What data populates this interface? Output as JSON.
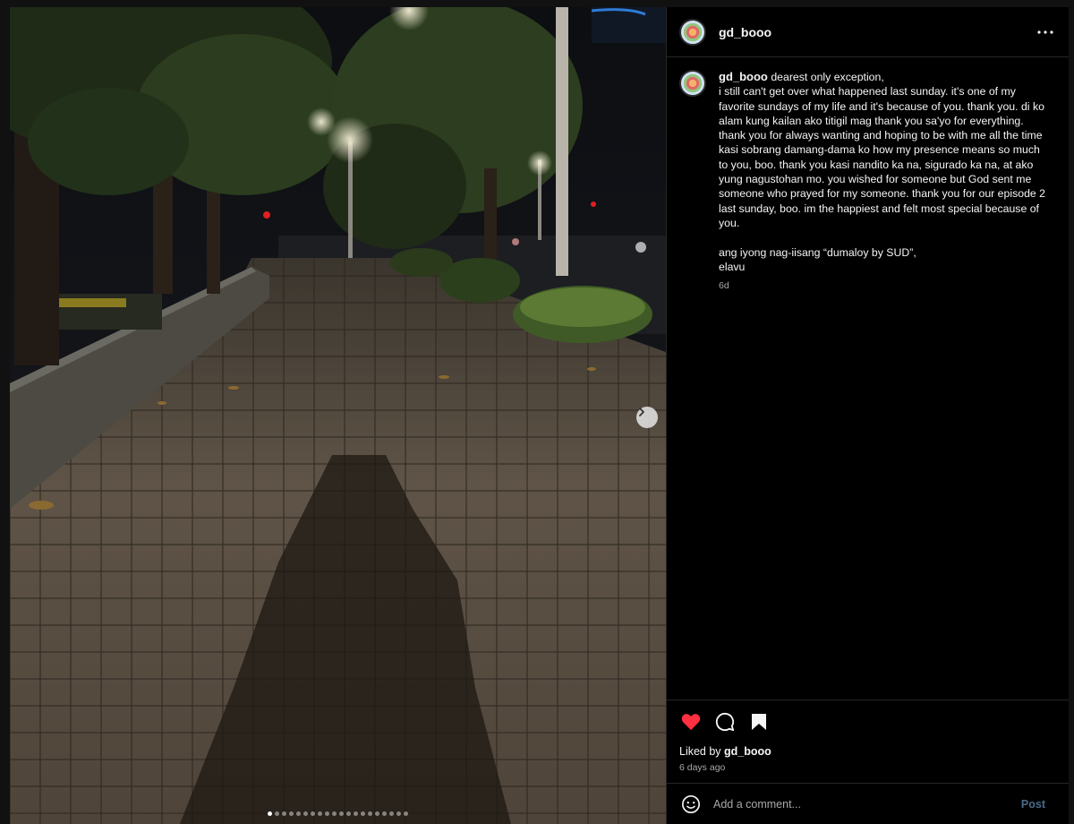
{
  "post": {
    "username": "gd_booo",
    "caption_lines": [
      "dearest only exception,",
      "i still can't get over what happened last sunday. it's one of my favorite sundays of my life and it's because of you. thank you. di ko alam kung kailan ako titigil mag thank you sa'yo for everything. thank you for always wanting and hoping to be with me all the time kasi sobrang damang-dama ko how my presence means so much to you, boo. thank you kasi nandito ka na, sigurado ka na, at ako yung nagustohan mo. you wished for someone but God sent me someone who prayed for my someone. thank you for our episode 2 last sunday, boo. im the happiest and felt most special because of you.",
      "",
      "ang iyong nag-iisang “dumaloy by SUD”,",
      "elavu"
    ],
    "caption_time": "6d",
    "liked_by_label": "Liked by",
    "liked_by_user": "gd_booo",
    "date_text": "6 days ago",
    "liked": true,
    "carousel": {
      "slide_count": 20,
      "current_slide": 1
    }
  },
  "comment": {
    "placeholder": "Add a comment...",
    "post_label": "Post"
  },
  "colors": {
    "like_red": "#ff3040",
    "post_disabled": "#4a6a8a",
    "panel_bg": "#000000"
  },
  "icons": {
    "more": "more-horizontal-icon",
    "like": "heart-icon",
    "comment": "comment-icon",
    "save": "bookmark-icon",
    "emoji": "emoji-icon",
    "next": "chevron-right-icon"
  }
}
